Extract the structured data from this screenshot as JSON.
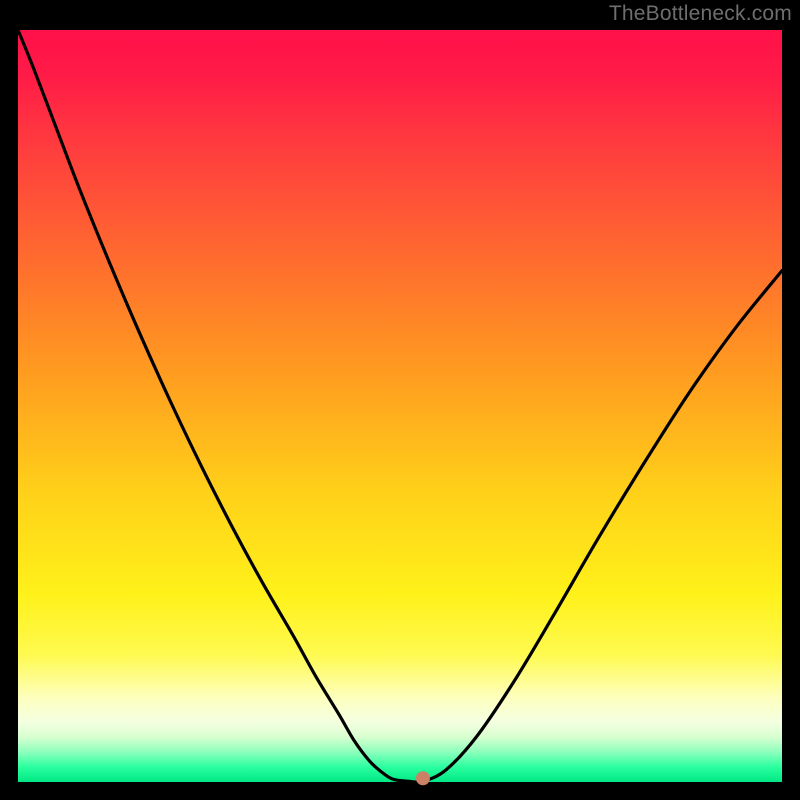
{
  "attribution": "TheBottleneck.com",
  "colors": {
    "curve": "#000000",
    "marker": "#cc8066",
    "gradient_top": "#ff1049",
    "gradient_bottom": "#00e885"
  },
  "chart_data": {
    "type": "line",
    "title": "",
    "xlabel": "",
    "ylabel": "",
    "xlim": [
      0,
      100
    ],
    "ylim": [
      0,
      100
    ],
    "x": [
      0,
      2,
      5,
      8,
      12,
      16,
      20,
      24,
      28,
      32,
      36,
      39,
      42,
      44,
      46,
      47.5,
      49,
      51,
      53,
      56,
      60,
      65,
      70,
      76,
      82,
      88,
      94,
      100
    ],
    "values": [
      100,
      95,
      87,
      79,
      69,
      59.5,
      50.5,
      42,
      34,
      26.5,
      19.5,
      14,
      9,
      5.5,
      2.8,
      1.4,
      0.4,
      0.1,
      0.1,
      1.6,
      6,
      13.5,
      22,
      32.5,
      42.5,
      52,
      60.5,
      68
    ],
    "marker": {
      "x": 53,
      "y": 0.5
    },
    "note": "V-shaped bottleneck curve on heat-gradient background; x-axis sweeps hardware balance, y-axis is bottleneck percentage. Gradient encodes severity (red=high, green=low)."
  }
}
